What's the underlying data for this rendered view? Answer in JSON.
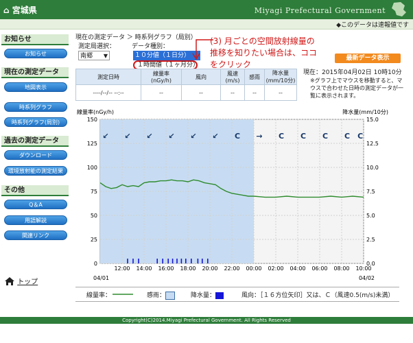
{
  "header": {
    "logo": "宮城県",
    "gov": "Miyagi Prefectural Government",
    "note": "◆このデータは速報値です"
  },
  "sidebar": {
    "sections": [
      {
        "title": "お知らせ",
        "items": [
          "お知らせ"
        ]
      },
      {
        "title": "現在の測定データ",
        "items": [
          "地図表示"
        ]
      },
      {
        "title": "",
        "items": [
          "時系列グラフ",
          "時系列グラフ(局別)"
        ]
      },
      {
        "title": "過去の測定データ",
        "items": [
          "ダウンロード",
          "環境放射能の測定結果"
        ]
      },
      {
        "title": "その他",
        "items": [
          "Q＆A",
          "用語解説",
          "関連リンク"
        ]
      }
    ],
    "top": "トップ"
  },
  "main": {
    "breadcrumb": "現在の測定データ ＞ 時系列グラフ（局別）",
    "station_label": "測定局選択：",
    "station_value": "南郷",
    "type_label": "データ種別：",
    "type_selected": "１０分値（１日分）",
    "type_option": "１時間値（１ヶ月分）",
    "annotation": "(3) 月ごとの空間放射線量の推移を知りたい場合は、ココをクリック",
    "latest_button": "最新データ表示",
    "now": "現在：2015年04月02日 10時10分",
    "tip": "※グラフ上でマウスを移動すると、マウスで合わせた日時の測定データが一覧に表示されます。",
    "table": {
      "headers": [
        "測定日時",
        "線量率\n(nGy/h)",
        "風向",
        "風速\n(m/s)",
        "感雨",
        "降水量\n(mm/10分)"
      ],
      "row": [
        "----/--/-- --:--",
        "--",
        "--",
        "--",
        "--",
        "--"
      ]
    }
  },
  "chart_data": {
    "type": "line",
    "left_axis_label": "線量率(nGy/h)",
    "right_axis_label": "降水量(mm/10分)",
    "ylim": [
      0,
      150
    ],
    "ylim_right": [
      0,
      15
    ],
    "yticks": [
      0,
      25,
      50,
      75,
      100,
      125,
      150
    ],
    "yticks_right": [
      "0.0",
      "2.5",
      "5.0",
      "7.5",
      "10.0",
      "12.5",
      "15.0"
    ],
    "xticks": [
      "12:00",
      "14:00",
      "16:00",
      "18:00",
      "20:00",
      "22:00",
      "00:00",
      "02:00",
      "04:00",
      "06:00",
      "08:00",
      "10:00"
    ],
    "xtick_hours": [
      12,
      14,
      16,
      18,
      20,
      22,
      24,
      26,
      28,
      30,
      32,
      34
    ],
    "x_start_label": "04/01",
    "x_end_label": "04/02",
    "x_range_hours": [
      10,
      34
    ],
    "rain_shade_hours": [
      10,
      24
    ],
    "dose": {
      "hours": [
        10,
        10.5,
        11,
        11.5,
        12,
        12.5,
        13,
        13.5,
        14,
        14.5,
        15,
        15.5,
        16,
        16.5,
        17,
        17.5,
        18,
        18.5,
        19,
        19.5,
        20,
        20.5,
        21,
        21.5,
        22,
        22.5,
        23,
        23.5,
        24,
        25,
        26,
        27,
        28,
        29,
        30,
        31,
        32,
        33,
        34
      ],
      "values": [
        84,
        80,
        78,
        79,
        82,
        80,
        81,
        80,
        84,
        85,
        85,
        86,
        86,
        87,
        86,
        86,
        85,
        87,
        86,
        84,
        83,
        82,
        78,
        75,
        73,
        72,
        71,
        70,
        70,
        69,
        69,
        70,
        69,
        69,
        69,
        70,
        69,
        70,
        69
      ]
    },
    "rain_ticks_hours": [
      12.5,
      13,
      13.5,
      15.2,
      15.7,
      16.2,
      16.6,
      17,
      17.4,
      17.8,
      18.3,
      18.9,
      19.3,
      19.8
    ],
    "wind_row": {
      "hours": [
        10.5,
        12.5,
        14.5,
        16.5,
        18.5,
        20.5,
        22.5,
        24.5,
        26.5,
        28.5,
        30.5,
        32.5,
        33.7
      ],
      "symbols": [
        "↙",
        "↙",
        "↙",
        "↙",
        "↙",
        "↙",
        "C",
        "→",
        "C",
        "C",
        "C",
        "C",
        "C"
      ]
    }
  },
  "legend": {
    "dose": "線量率：",
    "rain_sense": "感雨：",
    "precip": "降水量：",
    "wind": "風向：［１６方位矢印］又は、Ｃ（風速0.5(m/s)未満）"
  },
  "footer": "Copyright(C)2014.Miyagi Prefectural Government. All Rights Reserved",
  "colors": {
    "header": "#2e7d3a",
    "line": "#2e8b2e",
    "rain": "#1515d8",
    "shade": "#c7dcf2"
  }
}
